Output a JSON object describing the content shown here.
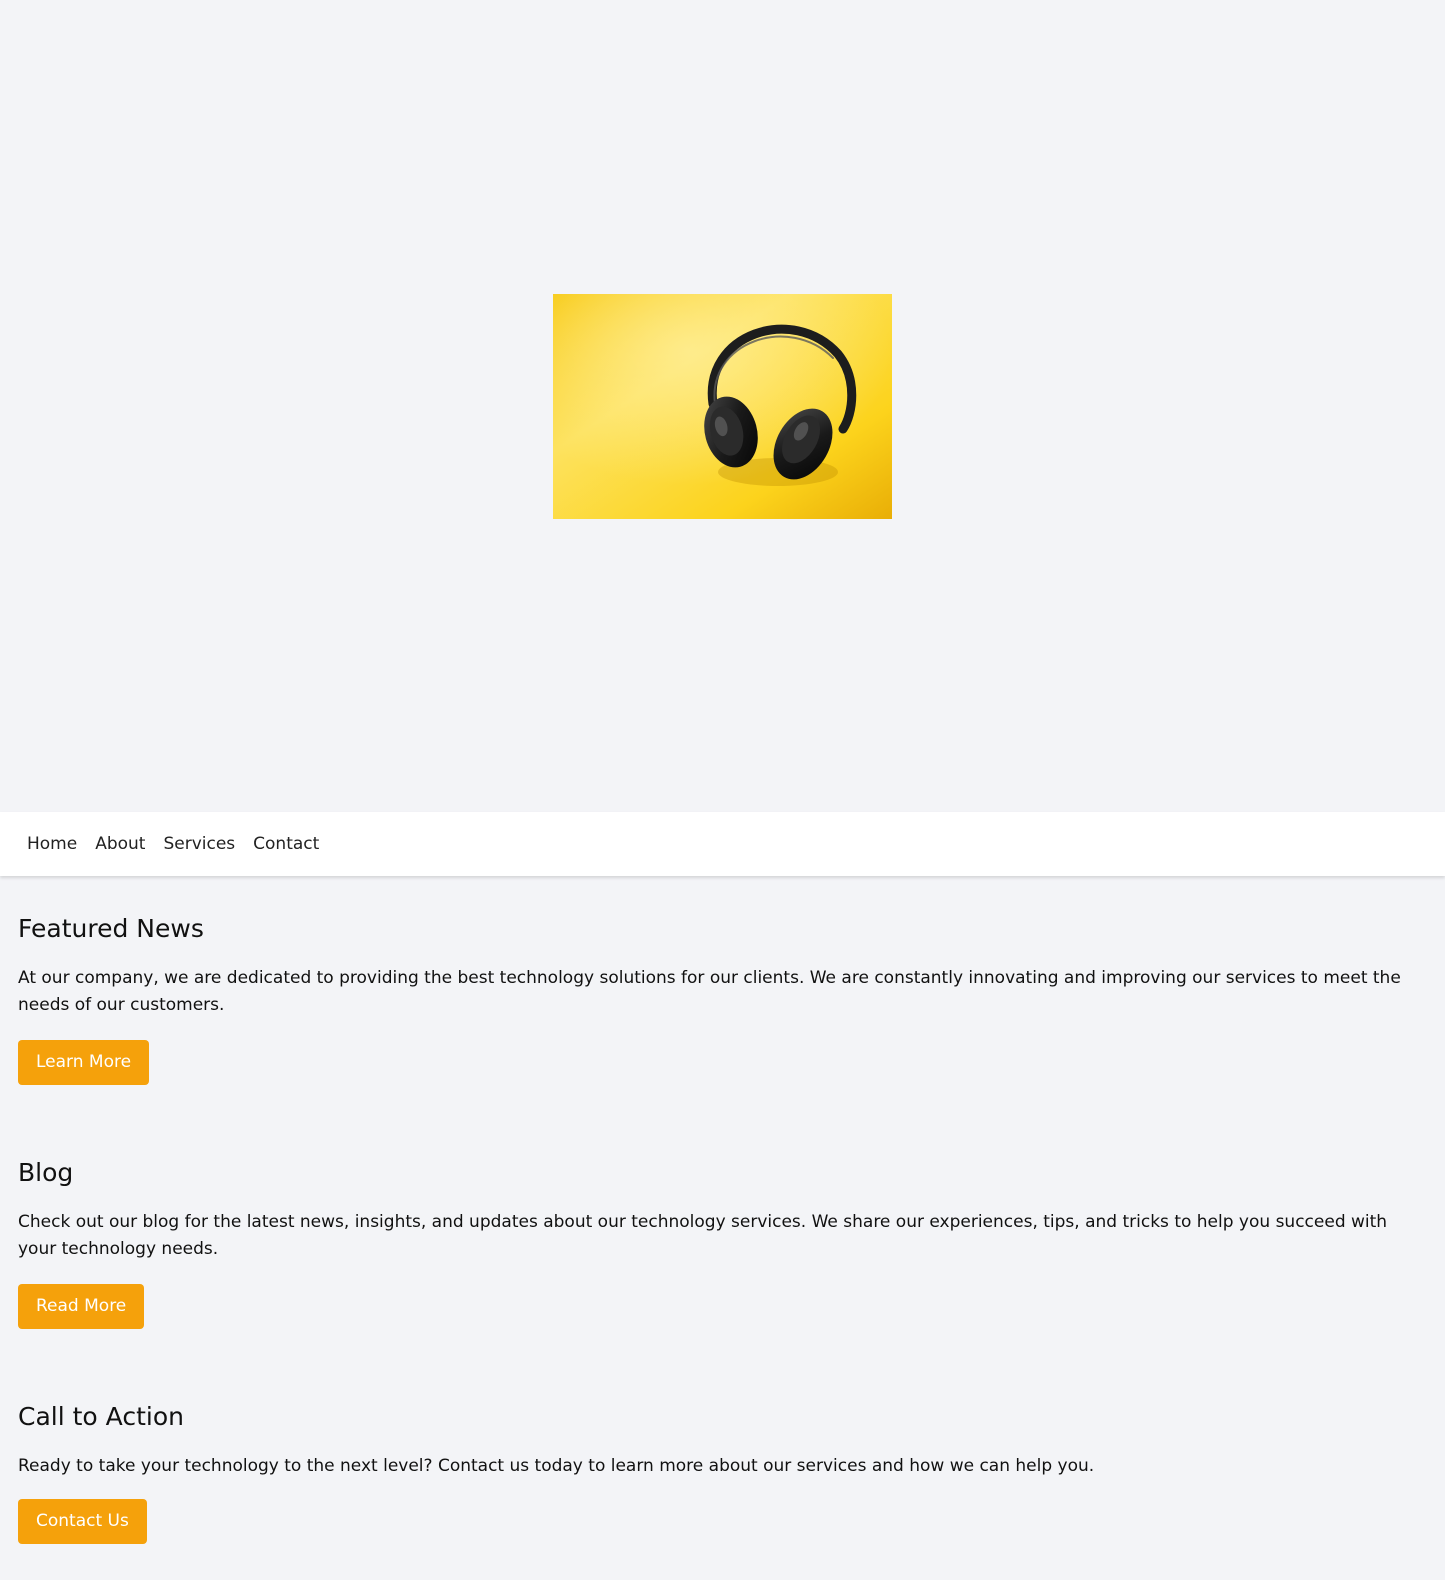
{
  "colors": {
    "page_background": "#f3f4f7",
    "nav_background": "#ffffff",
    "button_background": "#f5a10b",
    "button_text": "#ffffff"
  },
  "hero": {
    "image": "headphones-on-yellow-background"
  },
  "nav": {
    "items": [
      {
        "label": "Home"
      },
      {
        "label": "About"
      },
      {
        "label": "Services"
      },
      {
        "label": "Contact"
      }
    ]
  },
  "sections": {
    "featured": {
      "title": "Featured News",
      "body": "At our company, we are dedicated to providing the best technology solutions for our clients. We are constantly innovating and improving our services to meet the needs of our customers.",
      "button": "Learn More"
    },
    "blog": {
      "title": "Blog",
      "body": "Check out our blog for the latest news, insights, and updates about our technology services. We share our experiences, tips, and tricks to help you succeed with your technology needs.",
      "button": "Read More"
    },
    "cta": {
      "title": "Call to Action",
      "body": "Ready to take your technology to the next level? Contact us today to learn more about our services and how we can help you.",
      "button": "Contact Us"
    }
  }
}
